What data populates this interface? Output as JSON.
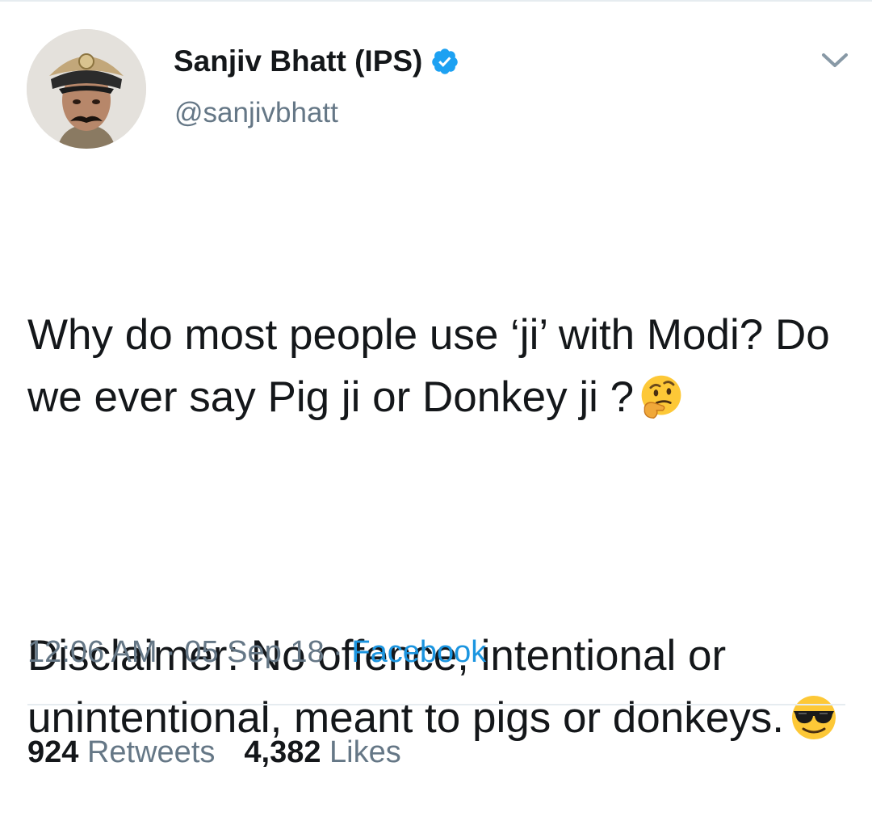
{
  "user": {
    "display_name": "Sanjiv Bhatt (IPS)",
    "handle": "@sanjivbhatt",
    "verified_icon": "verified-badge-icon"
  },
  "tweet": {
    "paragraph_1": "Why do most people use ‘ji’ with Modi? Do we ever say Pig ji or Donkey ji ?",
    "paragraph_1_emoji": "thinking-face-emoji",
    "paragraph_2": "Disclaimer: No offence, intentional or unintentional, meant to pigs or donkeys.",
    "paragraph_2_emoji": "smiling-face-with-sunglasses-emoji"
  },
  "meta": {
    "time": "12:06 AM",
    "separator": " · ",
    "date": "05 Sep 18",
    "source": "Facebook"
  },
  "stats": {
    "retweets_count": "924",
    "retweets_label": "Retweets",
    "likes_count": "4,382",
    "likes_label": "Likes"
  },
  "colors": {
    "text_primary": "#14171a",
    "text_secondary": "#657786",
    "link_blue": "#1b95e0",
    "verified_blue": "#1da1f2",
    "divider": "#e6ecf0"
  }
}
